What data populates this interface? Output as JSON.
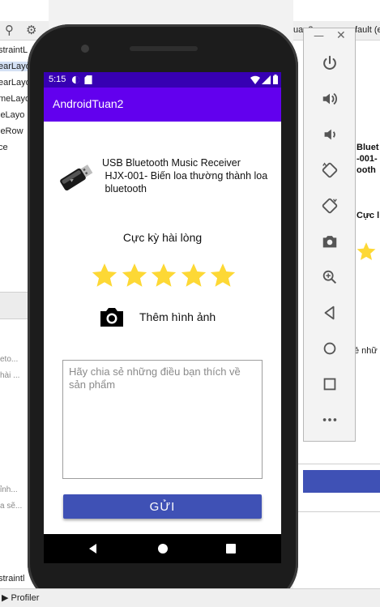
{
  "ide": {
    "tree_items": [
      "straintL",
      "earLayo",
      "earLayo",
      "meLayo",
      "leLayo",
      "leRow",
      "ce"
    ],
    "faded_lines": [
      "eto...",
      "hài ...",
      "ỉnh...",
      "a sẽ..."
    ],
    "bottom_left_label": "straintl",
    "profiler_tab": "Profiler",
    "right_top_text": "uan2",
    "right_default_text": "fault (e",
    "right_preview_lines": [
      "Bluet",
      "-001-",
      "ooth"
    ],
    "right_rating_text": "Cực l",
    "right_small_text": "ẻ nhữ"
  },
  "emulator_toolbar": {
    "buttons": [
      "power-icon",
      "volume-up-icon",
      "volume-down-icon",
      "rotate-left-icon",
      "rotate-right-icon",
      "screenshot-icon",
      "zoom-icon",
      "back-icon",
      "home-icon",
      "overview-icon",
      "more-icon"
    ]
  },
  "phone": {
    "status_time": "5:15",
    "app_title": "AndroidTuan2",
    "product_name": "USB Bluetooth Music Receiver\n HJX-001- Biến loa thường thành loa\n bluetooth",
    "rating_label": "Cực kỳ hài lòng",
    "rating": 5,
    "rating_max": 5,
    "star_color": "#fdd835",
    "add_photo_label": "Thêm hình ảnh",
    "review_placeholder": "Hãy chia sẻ những điều bạn thích về sản phẩm",
    "send_label": "GỬI",
    "accent_color": "#3f51b5",
    "status_bar_color": "#3700b3",
    "app_bar_color": "#6200ee"
  }
}
